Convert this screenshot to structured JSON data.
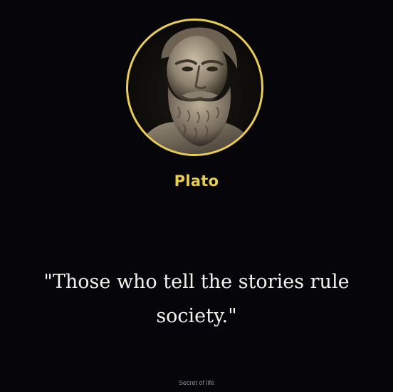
{
  "author": {
    "name": "Plato",
    "portrait_icon": "bust-portrait-icon"
  },
  "quote": {
    "text": "\"Those who tell the stories rule society.\""
  },
  "footer": {
    "text": "Secret of life"
  },
  "colors": {
    "background": "#05050a",
    "accent": "#e8cd52",
    "quote_text": "#f4f2ec",
    "footer_text": "#8d8d94"
  }
}
